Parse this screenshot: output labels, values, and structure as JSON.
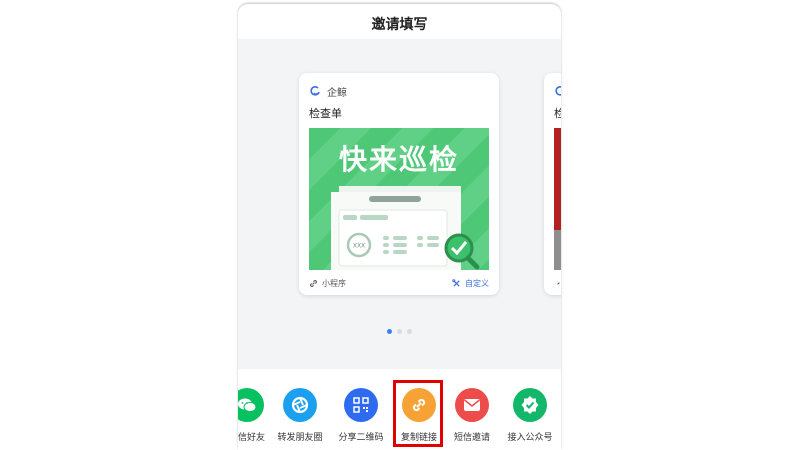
{
  "sheet": {
    "title": "邀请填写"
  },
  "card": {
    "brand": "企鲸",
    "title": "检查单",
    "banner_text": "快来巡检",
    "badge": "XXX",
    "footer_left": "小程序",
    "footer_right": "自定义"
  },
  "peek_card": {
    "title_fragment": "检"
  },
  "pagination": {
    "count": 3,
    "active_index": 0
  },
  "share": [
    {
      "label": "微信好友",
      "icon": "wechat-icon",
      "color": "#07c160"
    },
    {
      "label": "转发朋友圈",
      "icon": "moments-icon",
      "color": "#1aa0ef"
    },
    {
      "label": "分享二维码",
      "icon": "qrcode-icon",
      "color": "#2f6bf0"
    },
    {
      "label": "复制链接",
      "icon": "link-icon",
      "color": "#f7a234"
    },
    {
      "label": "短信邀请",
      "icon": "mail-icon",
      "color": "#ee4b4b"
    },
    {
      "label": "接入公众号",
      "icon": "verified-icon",
      "color": "#12b76a"
    }
  ],
  "highlight": {
    "target": "复制链接",
    "color": "#e00000"
  }
}
